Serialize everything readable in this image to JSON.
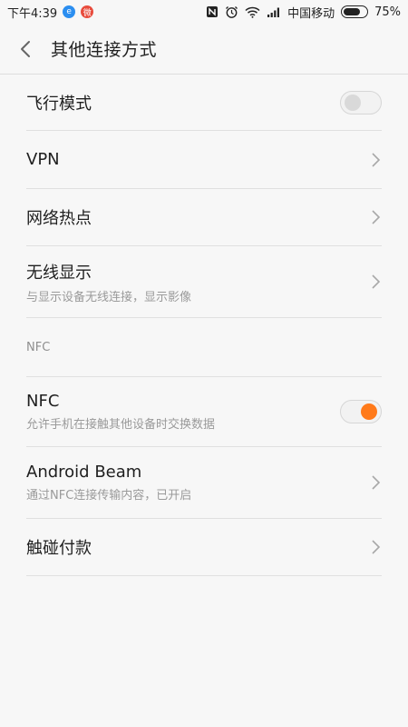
{
  "status_bar": {
    "time": "下午4:39",
    "carrier": "中国移动",
    "battery": "75%",
    "battery_level": 0.75,
    "icons": [
      "nfc-icon",
      "alarm-icon",
      "wifi-icon",
      "signal-icon",
      "battery-icon"
    ]
  },
  "header": {
    "title": "其他连接方式"
  },
  "items": [
    {
      "label": "飞行模式",
      "control": "toggle",
      "state": "off"
    },
    {
      "label": "VPN",
      "control": "chevron"
    },
    {
      "label": "网络热点",
      "control": "chevron"
    },
    {
      "label": "无线显示",
      "sub": "与显示设备无线连接，显示影像",
      "control": "chevron"
    }
  ],
  "nfc_section": {
    "header": "NFC",
    "items": [
      {
        "label": "NFC",
        "sub": "允许手机在接触其他设备时交换数据",
        "control": "toggle",
        "state": "on"
      },
      {
        "label": "Android Beam",
        "sub": "通过NFC连接传输内容，已开启",
        "control": "chevron"
      },
      {
        "label": "触碰付款",
        "control": "chevron"
      }
    ]
  },
  "colors": {
    "accent": "#ff7a1a",
    "background": "#f7f7f7"
  }
}
